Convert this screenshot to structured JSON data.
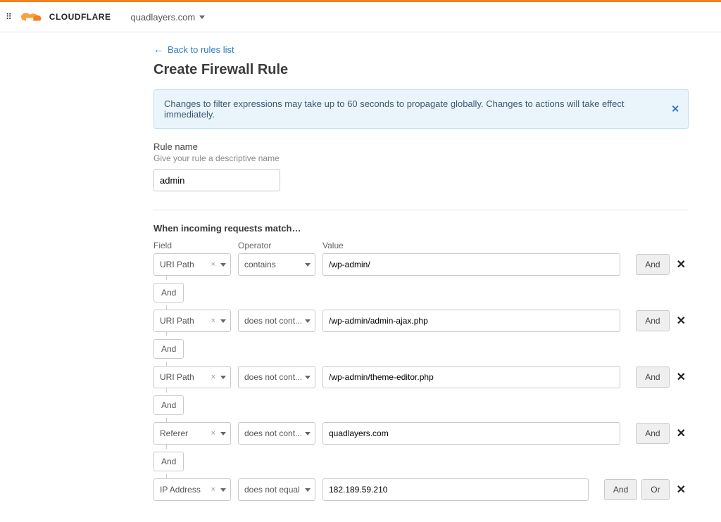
{
  "header": {
    "brand": "CLOUDFLARE",
    "domain": "quadlayers.com"
  },
  "nav": {
    "back_label": "Back to rules list"
  },
  "page": {
    "title": "Create Firewall Rule",
    "info_banner": "Changes to filter expressions may take up to 60 seconds to propagate globally. Changes to actions will take effect immediately."
  },
  "rule_name": {
    "label": "Rule name",
    "hint": "Give your rule a descriptive name",
    "value": "admin"
  },
  "match": {
    "title": "When incoming requests match…",
    "col_field": "Field",
    "col_operator": "Operator",
    "col_value": "Value",
    "and_label": "And",
    "or_label": "Or",
    "rows": [
      {
        "field": "URI Path",
        "operator": "contains",
        "value": "/wp-admin/",
        "actions": [
          "And"
        ]
      },
      {
        "field": "URI Path",
        "operator": "does not cont...",
        "value": "/wp-admin/admin-ajax.php",
        "actions": [
          "And"
        ]
      },
      {
        "field": "URI Path",
        "operator": "does not cont...",
        "value": "/wp-admin/theme-editor.php",
        "actions": [
          "And"
        ]
      },
      {
        "field": "Referer",
        "operator": "does not cont...",
        "value": "quadlayers.com",
        "actions": [
          "And"
        ]
      },
      {
        "field": "IP Address",
        "operator": "does not equal",
        "value": "182.189.59.210",
        "actions": [
          "And",
          "Or"
        ]
      }
    ],
    "connectors": [
      "And",
      "And",
      "And",
      "And"
    ]
  }
}
